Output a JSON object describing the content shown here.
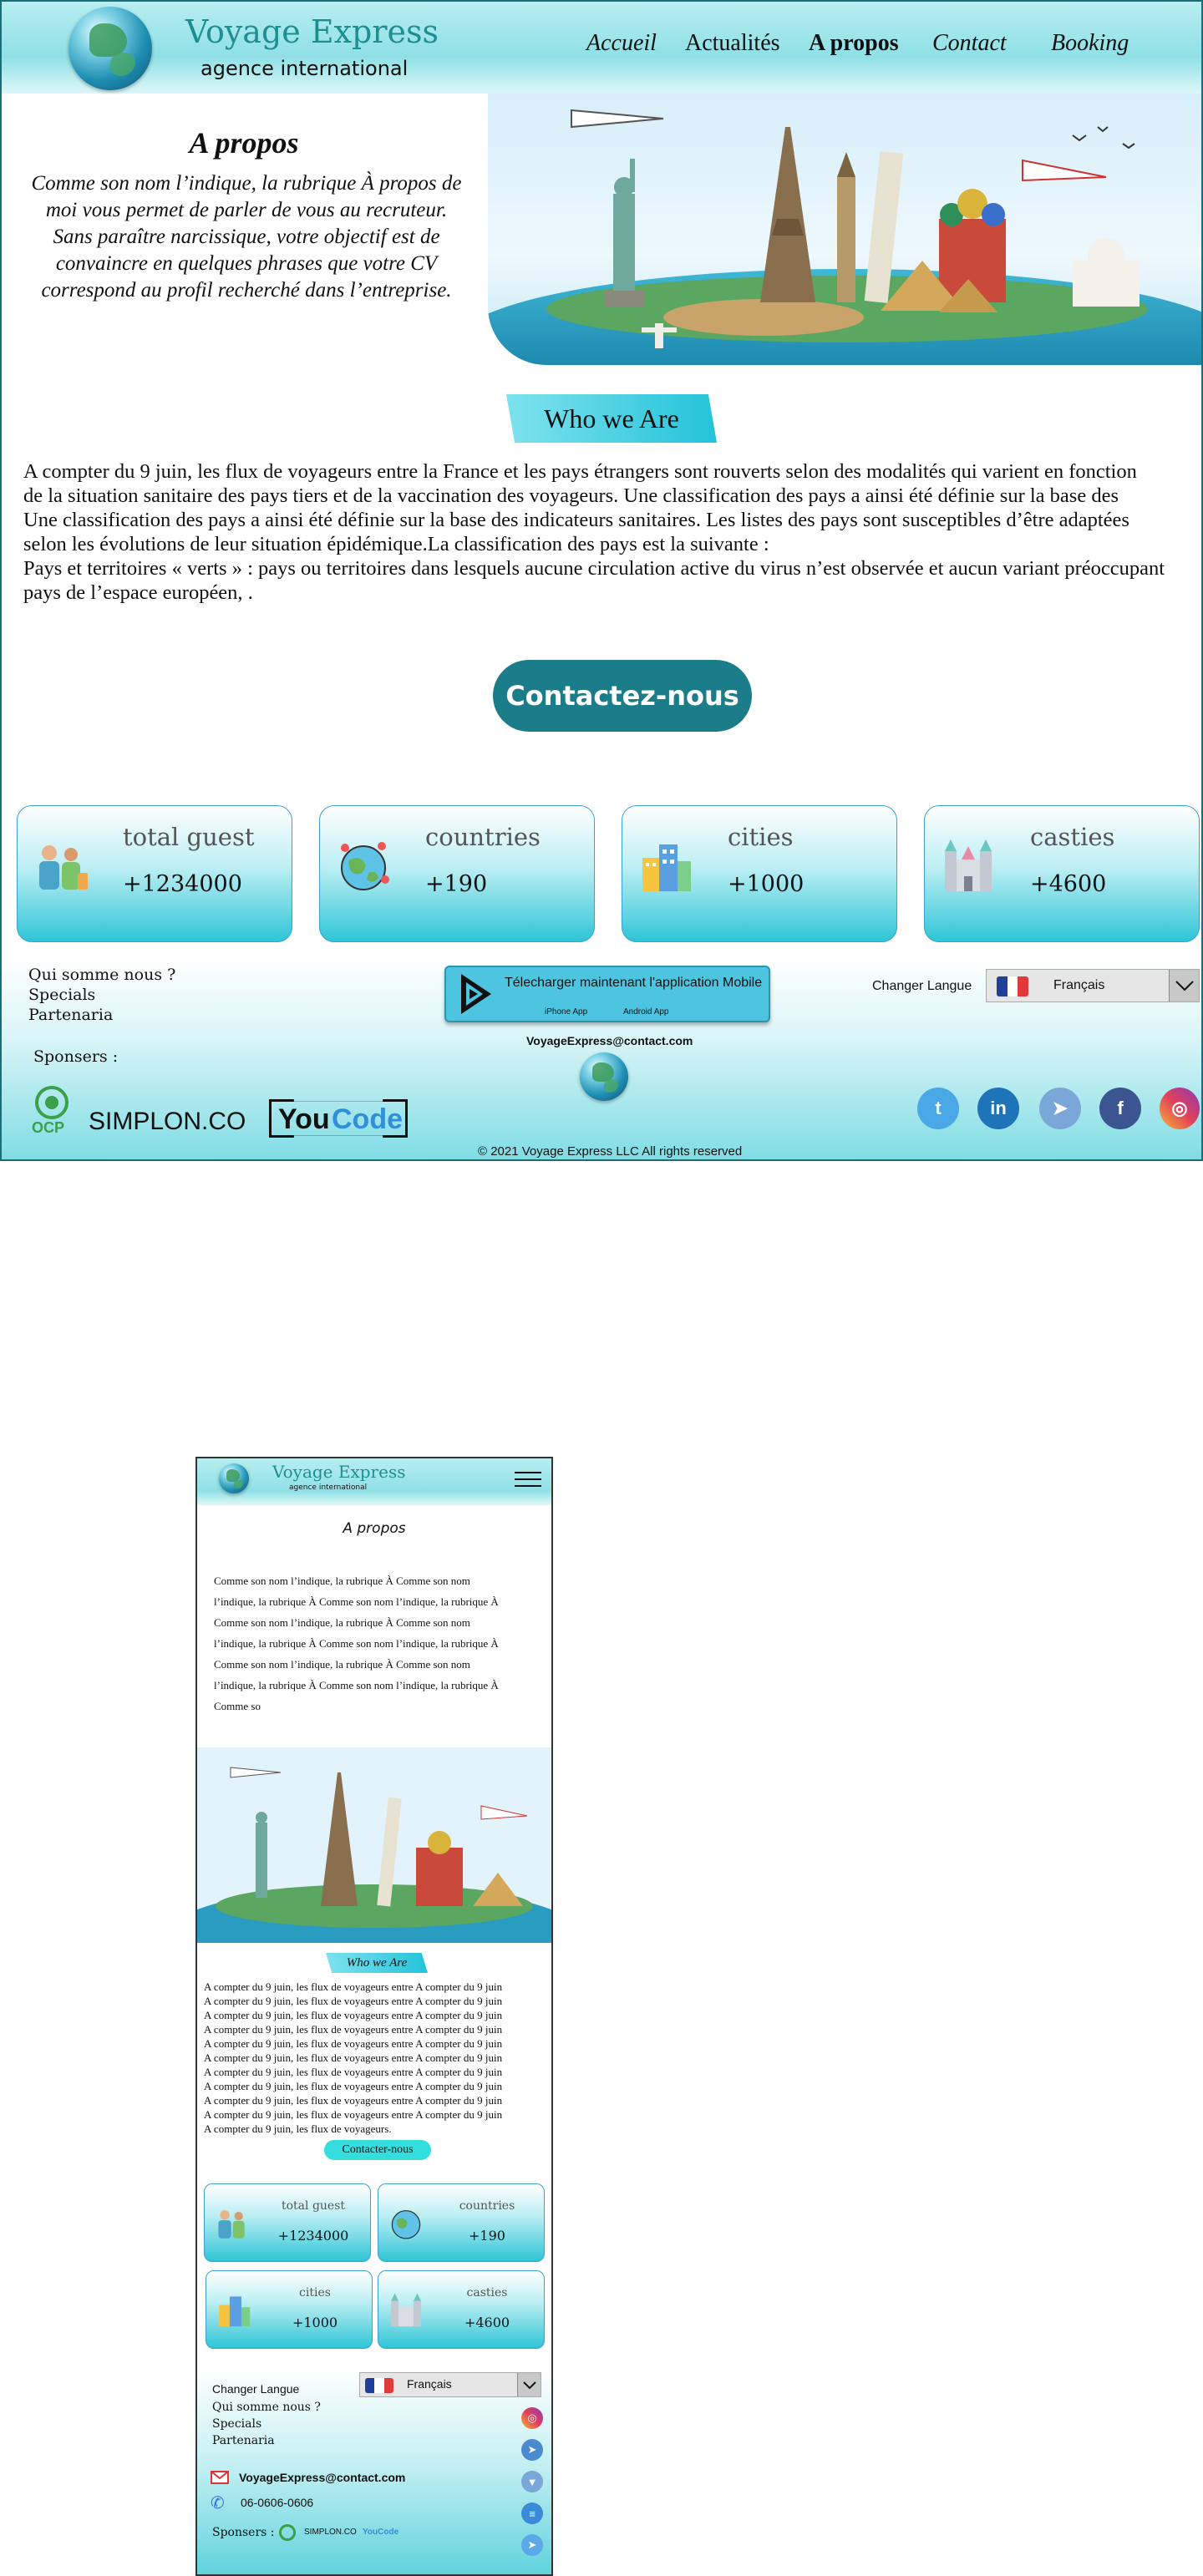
{
  "brand": {
    "name": "Voyage Express",
    "subtitle": "agence international"
  },
  "nav": {
    "items": [
      {
        "label": "Accueil"
      },
      {
        "label": "Actualités"
      },
      {
        "label": "A propos"
      },
      {
        "label": "Contact"
      },
      {
        "label": "Booking"
      }
    ]
  },
  "intro": {
    "title": "A propos",
    "text": "Comme son nom l’indique, la rubrique À propos de moi vous permet de parler de vous au recruteur. Sans paraître narcissique, votre objectif est de convaincre en quelques phrases que votre CV correspond au profil recherché dans l’entreprise."
  },
  "who": {
    "title": "Who we Are",
    "lines": [
      "A compter du 9 juin, les flux de voyageurs entre la France et les pays  étrangers sont rouverts selon des modalités qui varient en fonction",
      "de la situation sanitaire des pays tiers et de la vaccination des voyageurs. Une classification des pays a ainsi été définie sur la base des",
      "Une classification des pays a ainsi été définie sur la base des indicateurs sanitaires. Les listes des pays sont susceptibles d’être  adaptées",
      "selon les évolutions de leur situation épidémique.La classification des pays est la suivante :",
      "Pays et territoires « verts » : pays ou territoires dans lesquels aucune circulation active du virus n’est observée et aucun variant préoccupant",
      "pays de l’espace européen, ."
    ]
  },
  "cta": {
    "label": "Contactez-nous"
  },
  "stats": [
    {
      "label": "total guest",
      "value": "+1234000"
    },
    {
      "label": "countries",
      "value": "+190"
    },
    {
      "label": "cities",
      "value": "+1000"
    },
    {
      "label": "casties",
      "value": "+4600"
    }
  ],
  "footer": {
    "links": [
      "Qui somme nous ?",
      "Specials",
      "Partenaria"
    ],
    "sponsors_label": "Sponsers :",
    "app": {
      "title": "Télecharger maintenant l'application Mobile",
      "iphone": "iPhone App",
      "android": "Android App"
    },
    "email": "VoyageExpress@contact.com",
    "language": {
      "label": "Changer Langue",
      "selected": "Français"
    },
    "copyright": "© 2021 Voyage Express LLC All rights reserved",
    "sponsors": {
      "ocp": "OCP",
      "simplon": "SIMPLON.CO",
      "youcode_you": "You",
      "youcode_code": "Code"
    }
  },
  "mobile": {
    "brand": {
      "name": "Voyage Express",
      "subtitle": "agence international"
    },
    "title": "A propos",
    "intro_lines": [
      "Comme son nom l’indique, la rubrique À Comme son nom",
      "l’indique, la rubrique À Comme son nom l’indique, la rubrique À",
      "Comme son nom l’indique, la rubrique À Comme son nom",
      "l’indique, la rubrique À Comme son nom l’indique, la rubrique À",
      "Comme son nom l’indique, la rubrique À Comme son nom",
      "l’indique, la rubrique À Comme son nom l’indique, la rubrique À",
      "Comme so"
    ],
    "who_title": "Who we Are",
    "body_lines": [
      "A compter du 9 juin, les flux de voyageurs entre A compter du 9 juin",
      "A compter du 9 juin, les flux de voyageurs entre A compter du 9 juin",
      "A compter du 9 juin, les flux de voyageurs entre A compter du 9 juin",
      "A compter du 9 juin, les flux de voyageurs entre A compter du 9 juin",
      "A compter du 9 juin, les flux de voyageurs entre A compter du 9 juin",
      "A compter du 9 juin, les flux de voyageurs entre A compter du 9 juin",
      "A compter du 9 juin, les flux de voyageurs entre A compter du 9 juin",
      "A compter du 9 juin, les flux de voyageurs entre A compter du 9 juin",
      "A compter du 9 juin, les flux de voyageurs entre A compter du 9 juin",
      "A compter du 9 juin, les flux de voyageurs entre A compter du 9 juin",
      "A compter du 9 juin, les flux de voyageurs."
    ],
    "cta": "Contacter-nous",
    "stats": [
      {
        "label": "total guest",
        "value": "+1234000"
      },
      {
        "label": "countries",
        "value": "+190"
      },
      {
        "label": "cities",
        "value": "+1000"
      },
      {
        "label": "casties",
        "value": "+4600"
      }
    ],
    "footer": {
      "lang_label": "Changer Langue",
      "lang_selected": "Français",
      "links": [
        "Qui somme nous ?",
        "Specials",
        "Partenaria"
      ],
      "email": "VoyageExpress@contact.com",
      "phone": "06-0606-0606",
      "sponsors_label": "Sponsers :",
      "sponsor_simplon": "SIMPLON.CO",
      "sponsor_youcode": "YouCode"
    }
  },
  "colors": {
    "accent": "#1e8f91",
    "cta": "#1c7d8a",
    "banner": "#23c3d9",
    "stat_border": "#3aa0d8"
  },
  "icons": [
    "globe-logo-icon",
    "hamburger-icon",
    "play-store-icon",
    "chevron-down-icon",
    "french-flag-icon",
    "twitter-icon",
    "linkedin-icon",
    "telegram-icon",
    "facebook-icon",
    "instagram-icon",
    "gmail-icon",
    "phone-icon"
  ]
}
